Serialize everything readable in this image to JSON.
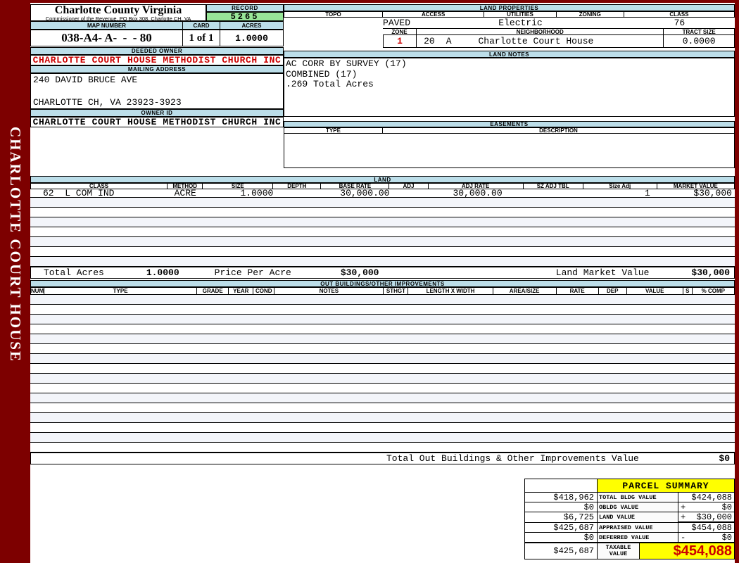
{
  "page": {
    "sidebar_text": "CHARLOTTE COURT HOUSE",
    "colors": {
      "frame_maroon": "#7d0000",
      "section_header_blue": "#bcdee9",
      "record_green": "#98e698",
      "highlight_yellow": "#ffff00",
      "acres_cream": "#efefdf",
      "alt_row": "#f3f5fa",
      "alert_red": "#cc0000"
    }
  },
  "header": {
    "county_title": "Charlotte County Virginia",
    "county_subtitle": "Commissioner of the Revenue, PO Box 308, Charlotte CH, VA",
    "record_label": "RECORD",
    "record_value": "5265",
    "map_number_label": "MAP NUMBER",
    "map_number_value": "038-A4- A-  -  - 80",
    "card_label": "CARD",
    "card_value": "1 of 1",
    "acres_label": "ACRES",
    "acres_value": "1.0000"
  },
  "owner": {
    "deeded_owner_label": "DEEDED OWNER",
    "deeded_owner": "CHARLOTTE COURT HOUSE METHODIST CHURCH INC",
    "mailing_address_label": "MAILING ADDRESS",
    "address_line1": "240 DAVID BRUCE AVE",
    "address_line2": "CHARLOTTE CH, VA 23923-3923",
    "owner_id_label": "OWNER ID",
    "owner_id": "CHARLOTTE COURT HOUSE METHODIST CHURCH INC"
  },
  "land_properties": {
    "title": "LAND PROPERTIES",
    "topo_label": "TOPO",
    "topo": "",
    "access_label": "ACCESS",
    "access": "PAVED",
    "utilities_label": "UTILITIES",
    "utilities": "Electric",
    "zoning_label": "ZONING",
    "zoning": "",
    "class_label": "CLASS",
    "class": "76",
    "zone_label": "ZONE",
    "zone": "1",
    "neighborhood_label": "NEIGHBORHOOD",
    "neighborhood_code": "20",
    "neighborhood_sub": "A",
    "neighborhood_name": "Charlotte Court House",
    "tract_size_label": "TRACT SIZE",
    "tract_size": "0.0000"
  },
  "land_notes": {
    "title": "LAND NOTES",
    "line1": "AC CORR BY SURVEY (17)",
    "line2": "COMBINED (17)",
    "line3": ".269 Total Acres"
  },
  "easements": {
    "title": "EASEMENTS",
    "type_label": "TYPE",
    "description_label": "DESCRIPTION"
  },
  "land_table": {
    "title": "LAND",
    "headers": [
      "CLASS",
      "METHOD",
      "SIZE",
      "DEPTH",
      "BASE RATE",
      "ADJ",
      "ADJ RATE",
      "SZ ADJ TBL",
      "Size Adj",
      "MARKET VALUE"
    ],
    "row1": {
      "class": "62  L COM IND",
      "method": "ACRE",
      "size": "1.0000",
      "depth": "",
      "base_rate": "30,000.00",
      "adj": "",
      "adj_rate": "30,000.00",
      "sz_adj_tbl": "",
      "size_adj": "1",
      "market_value": "$30,000"
    },
    "totals": {
      "total_acres_label": "Total Acres",
      "total_acres": "1.0000",
      "price_per_acre_label": "Price Per Acre",
      "price_per_acre": "$30,000",
      "land_market_value_label": "Land Market Value",
      "land_market_value": "$30,000"
    }
  },
  "out_buildings": {
    "title": "OUT BUILDINGS/OTHER IMPROVEMENTS",
    "headers": [
      "NUM",
      "TYPE",
      "GRADE",
      "YEAR",
      "COND",
      "NOTES",
      "STHGT",
      "LENGTH X WIDTH",
      "AREA/SIZE",
      "RATE",
      "DEP",
      "VALUE",
      "S",
      "% COMP"
    ],
    "total_label": "Total Out Buildings & Other Improvements Value",
    "total_value": "$0"
  },
  "parcel_summary": {
    "title": "PARCEL SUMMARY",
    "rows": [
      {
        "prior": "$418,962",
        "label": "TOTAL BLDG VALUE",
        "sign": "",
        "amount": "$424,088"
      },
      {
        "prior": "$0",
        "label": "OBLDG VALUE",
        "sign": "+",
        "amount": "$0"
      },
      {
        "prior": "$6,725",
        "label": "LAND VALUE",
        "sign": "+",
        "amount": "$30,000"
      },
      {
        "prior": "$425,687",
        "label": "APPRAISED VALUE",
        "sign": "",
        "amount": "$454,088"
      },
      {
        "prior": "$0",
        "label": "DEFERRED VALUE",
        "sign": "-",
        "amount": "$0"
      }
    ],
    "taxable": {
      "prior": "$425,687",
      "label_line1": "TAXABLE",
      "label_line2": "VALUE",
      "amount": "$454,088"
    }
  }
}
